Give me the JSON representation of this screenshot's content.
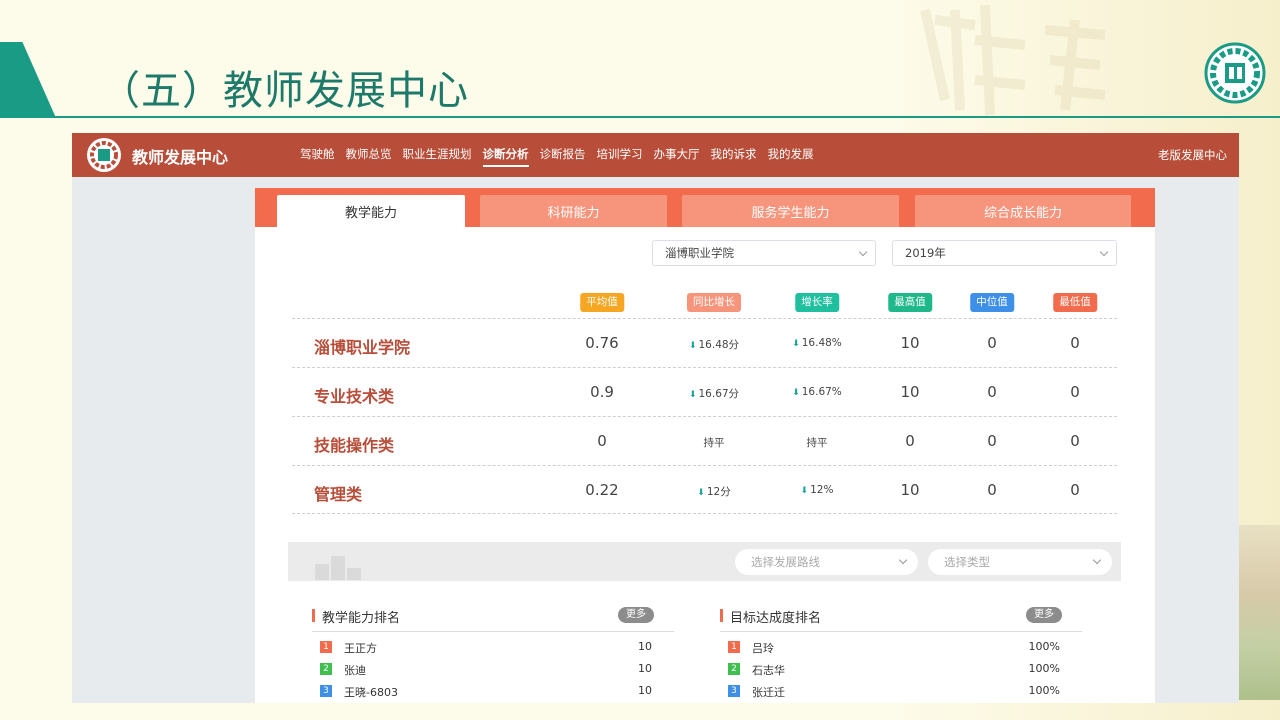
{
  "slide": {
    "title": "（五）教师发展中心"
  },
  "colors": {
    "nav_bg": "#b84e3a",
    "tab_bar": "#f26b4c",
    "tab_inactive": "#f7957c",
    "accent_teal": "#1a9b86",
    "down_arrow": "#1aa39a"
  },
  "topnav": {
    "brand": "教师发展中心",
    "items": [
      {
        "label": "驾驶舱",
        "active": false
      },
      {
        "label": "教师总览",
        "active": false
      },
      {
        "label": "职业生涯规划",
        "active": false
      },
      {
        "label": "诊断分析",
        "active": true
      },
      {
        "label": "诊断报告",
        "active": false
      },
      {
        "label": "培训学习",
        "active": false
      },
      {
        "label": "办事大厅",
        "active": false
      },
      {
        "label": "我的诉求",
        "active": false
      },
      {
        "label": "我的发展",
        "active": false
      }
    ],
    "old_version": "老版发展中心"
  },
  "tabs": [
    {
      "label": "教学能力",
      "active": true
    },
    {
      "label": "科研能力",
      "active": false
    },
    {
      "label": "服务学生能力",
      "active": false
    },
    {
      "label": "综合成长能力",
      "active": false
    }
  ],
  "filters": {
    "school": "淄博职业学院",
    "year": "2019年"
  },
  "stats": {
    "headers": [
      {
        "label": "平均值",
        "color": "#f5a623"
      },
      {
        "label": "同比增长",
        "color": "#f7957c"
      },
      {
        "label": "增长率",
        "color": "#1fbf9f"
      },
      {
        "label": "最高值",
        "color": "#1fb88a"
      },
      {
        "label": "中位值",
        "color": "#3d8fe8"
      },
      {
        "label": "最低值",
        "color": "#f26b4c"
      }
    ],
    "rows": [
      {
        "name": "淄博职业学院",
        "avg": "0.76",
        "yoy": "16.48分",
        "yoy_down": true,
        "rate": "16.48%",
        "rate_down": true,
        "max": "10",
        "median": "0",
        "min": "0"
      },
      {
        "name": "专业技术类",
        "avg": "0.9",
        "yoy": "16.67分",
        "yoy_down": true,
        "rate": "16.67%",
        "rate_down": true,
        "max": "10",
        "median": "0",
        "min": "0"
      },
      {
        "name": "技能操作类",
        "avg": "0",
        "yoy": "持平",
        "yoy_down": false,
        "rate": "持平",
        "rate_down": false,
        "max": "0",
        "median": "0",
        "min": "0"
      },
      {
        "name": "管理类",
        "avg": "0.22",
        "yoy": "12分",
        "yoy_down": true,
        "rate": "12%",
        "rate_down": true,
        "max": "10",
        "median": "0",
        "min": "0"
      }
    ]
  },
  "filter_bar": {
    "path_placeholder": "选择发展路线",
    "type_placeholder": "选择类型"
  },
  "rankings": {
    "teaching": {
      "title": "教学能力排名",
      "more": "更多",
      "items": [
        {
          "rank": "1",
          "name": "王正方",
          "value": "10",
          "color": "#f26b4c"
        },
        {
          "rank": "2",
          "name": "张迪",
          "value": "10",
          "color": "#3fbf4f"
        },
        {
          "rank": "3",
          "name": "王晓-6803",
          "value": "10",
          "color": "#3d8fe8"
        }
      ]
    },
    "target": {
      "title": "目标达成度排名",
      "more": "更多",
      "items": [
        {
          "rank": "1",
          "name": "吕玲",
          "value": "100%",
          "color": "#f26b4c"
        },
        {
          "rank": "2",
          "name": "石志华",
          "value": "100%",
          "color": "#3fbf4f"
        },
        {
          "rank": "3",
          "name": "张迁迁",
          "value": "100%",
          "color": "#3d8fe8"
        }
      ]
    }
  }
}
